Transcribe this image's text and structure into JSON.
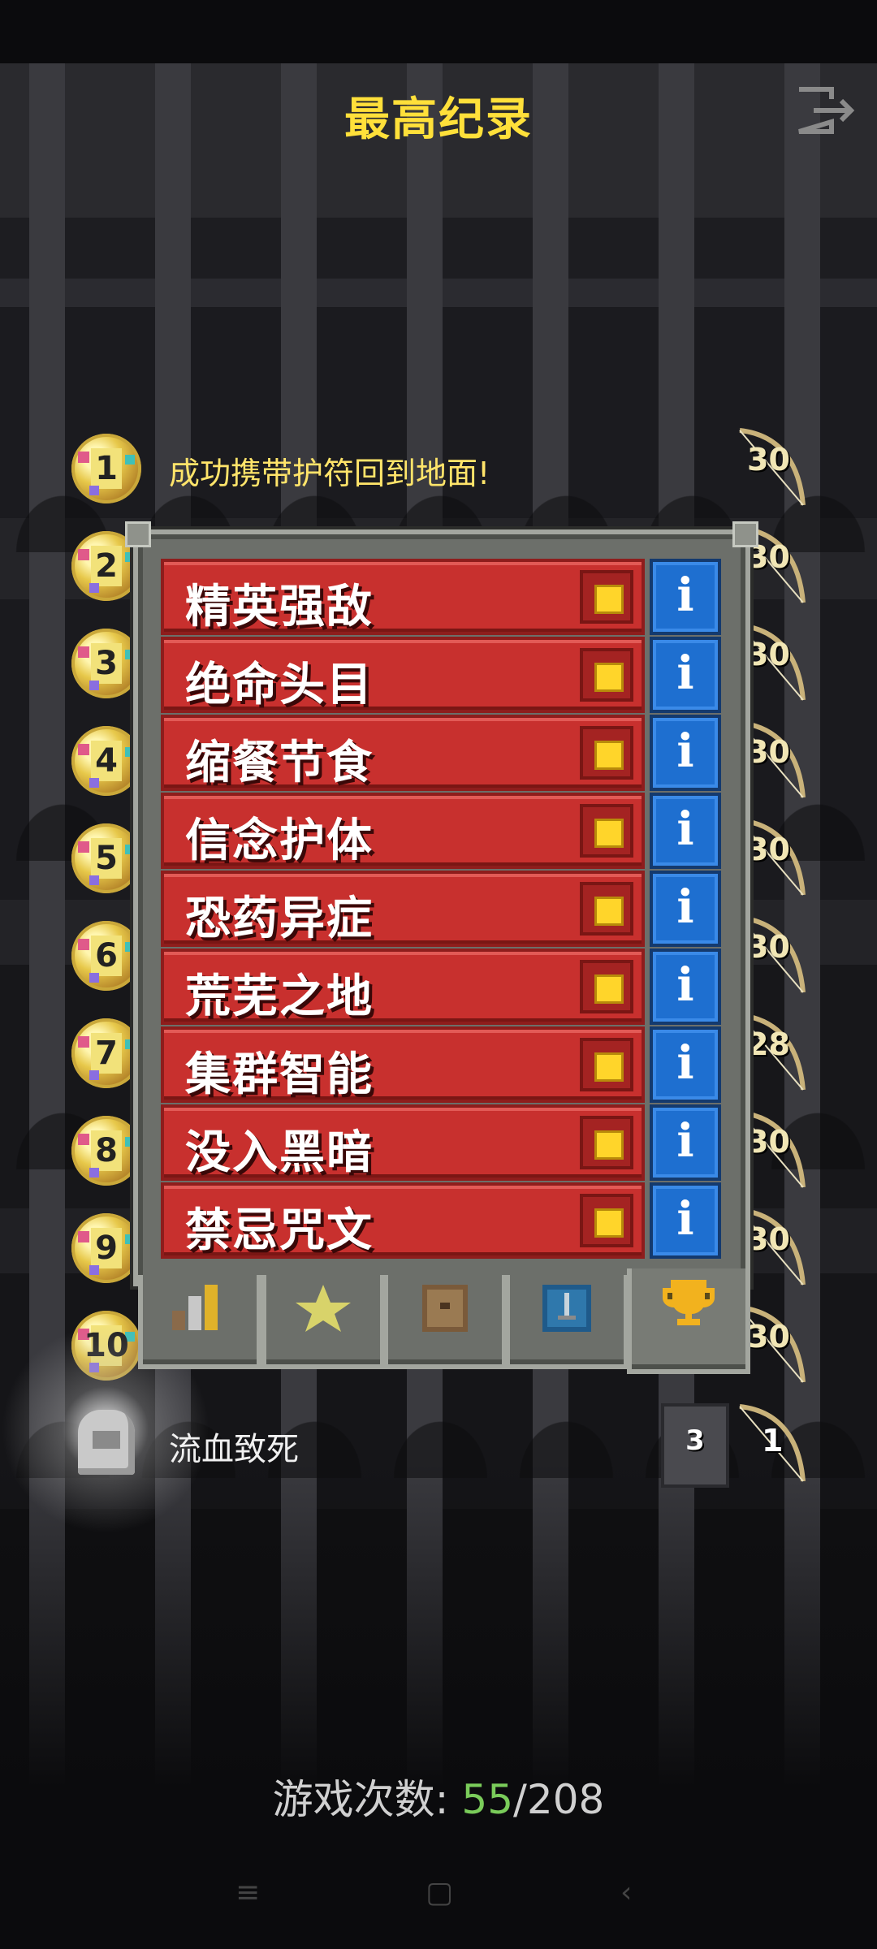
{
  "header": {
    "title": "最高纪录",
    "exit_icon": "exit-icon"
  },
  "rankings": [
    {
      "rank": "1",
      "description": "成功携带护符回到地面!",
      "level": "30"
    },
    {
      "rank": "2",
      "description": "",
      "level": "30"
    },
    {
      "rank": "3",
      "description": "",
      "level": "30"
    },
    {
      "rank": "4",
      "description": "",
      "level": "30"
    },
    {
      "rank": "5",
      "description": "",
      "level": "30"
    },
    {
      "rank": "6",
      "description": "",
      "level": "30"
    },
    {
      "rank": "7",
      "description": "",
      "level": "28"
    },
    {
      "rank": "8",
      "description": "",
      "level": "30"
    },
    {
      "rank": "9",
      "description": "",
      "level": "30"
    },
    {
      "rank": "10",
      "description": "",
      "level": "30"
    }
  ],
  "last_game": {
    "description": "流血致死",
    "depth": "3",
    "level": "1"
  },
  "challenges": [
    {
      "label": "精英强敌",
      "checked": true
    },
    {
      "label": "绝命头目",
      "checked": true
    },
    {
      "label": "缩餐节食",
      "checked": true
    },
    {
      "label": "信念护体",
      "checked": true
    },
    {
      "label": "恐药异症",
      "checked": true
    },
    {
      "label": "荒芜之地",
      "checked": true
    },
    {
      "label": "集群智能",
      "checked": true
    },
    {
      "label": "没入黑暗",
      "checked": true
    },
    {
      "label": "禁忌咒文",
      "checked": true
    }
  ],
  "info_label": "i",
  "tabs": [
    {
      "icon": "stats-icon",
      "active": false
    },
    {
      "icon": "star-icon",
      "active": false
    },
    {
      "icon": "journal-icon",
      "active": false
    },
    {
      "icon": "sword-icon",
      "active": false
    },
    {
      "icon": "trophy-icon",
      "active": true
    }
  ],
  "footer": {
    "label": "游戏次数: ",
    "current": "55",
    "separator": "/",
    "total": "208"
  },
  "colors": {
    "title": "#ffe03a",
    "challenge_red": "#c8302e",
    "info_blue": "#1e6fd0",
    "checkbox_gold": "#ffd52a",
    "games_current": "#7acc5a"
  }
}
